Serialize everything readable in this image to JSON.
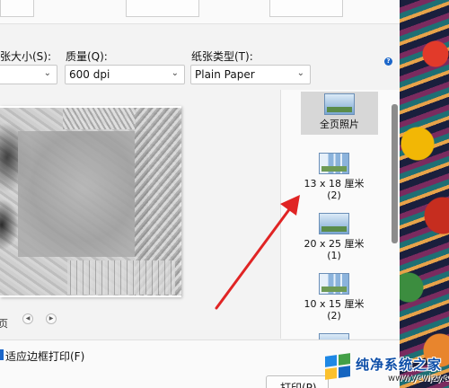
{
  "paper_size": {
    "label": "纸张大小(S):",
    "value": ""
  },
  "quality": {
    "label": "质量(Q):",
    "value": "600 dpi"
  },
  "paper_type": {
    "label": "纸张类型(T):",
    "value": "Plain Paper"
  },
  "help_icon": "?",
  "page_nav": {
    "text": "页"
  },
  "layouts": [
    {
      "label": "全页照片",
      "count": ""
    },
    {
      "label": "13 x 18 厘米",
      "count": "(2)"
    },
    {
      "label": "20 x 25 厘米",
      "count": "(1)"
    },
    {
      "label": "10 x 15 厘米",
      "count": "(2)"
    }
  ],
  "fit_frame": {
    "label": "适应边框打印(F)"
  },
  "print_button": {
    "label": "打印(P)"
  },
  "watermark": {
    "title": "纯净系统之家",
    "url": "www.ycwjzy.com"
  },
  "colors": {
    "accent": "#1b66c9",
    "arrow": "#e02424",
    "selected": "#d7d7d7"
  }
}
